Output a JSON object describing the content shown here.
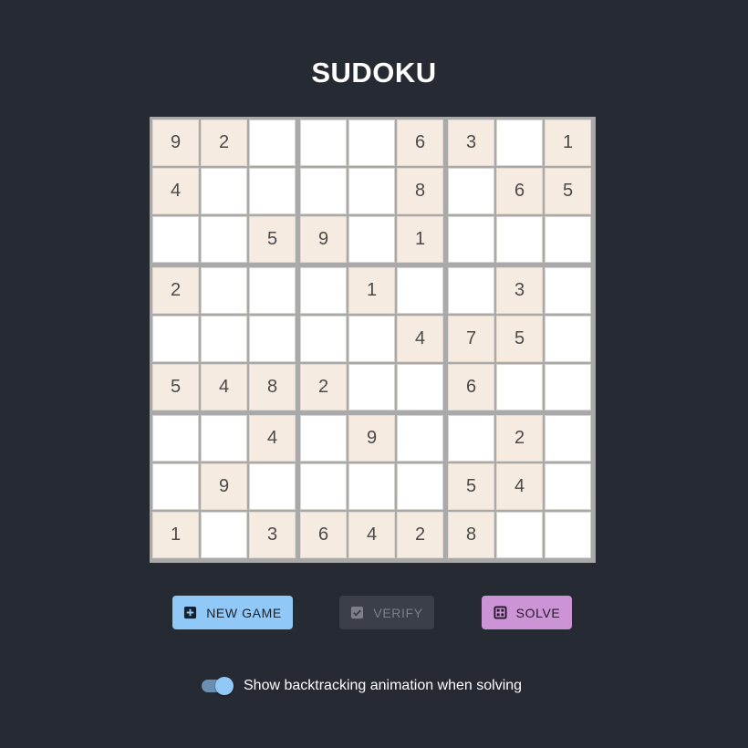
{
  "title": "SUDOKU",
  "board": {
    "grid": [
      [
        9,
        2,
        0,
        0,
        0,
        6,
        3,
        0,
        1
      ],
      [
        4,
        0,
        0,
        0,
        0,
        8,
        0,
        6,
        5
      ],
      [
        0,
        0,
        5,
        9,
        0,
        1,
        0,
        0,
        0
      ],
      [
        2,
        0,
        0,
        0,
        1,
        0,
        0,
        3,
        0
      ],
      [
        0,
        0,
        0,
        0,
        0,
        4,
        7,
        5,
        0
      ],
      [
        5,
        4,
        8,
        2,
        0,
        0,
        6,
        0,
        0
      ],
      [
        0,
        0,
        4,
        0,
        9,
        0,
        0,
        2,
        0
      ],
      [
        0,
        9,
        0,
        0,
        0,
        0,
        5,
        4,
        0
      ],
      [
        1,
        0,
        3,
        6,
        4,
        2,
        8,
        0,
        0
      ]
    ]
  },
  "buttons": {
    "new_game": {
      "label": "NEW GAME",
      "icon": "plus-box-icon",
      "enabled": true,
      "color": "#90c8f8"
    },
    "verify": {
      "label": "VERIFY",
      "icon": "checkbox-icon",
      "enabled": false,
      "color": "#3b3f48"
    },
    "solve": {
      "label": "SOLVE",
      "icon": "grid-solve-icon",
      "enabled": true,
      "color": "#cd93d7"
    }
  },
  "options": {
    "animation_toggle": {
      "label": "Show backtracking animation when solving",
      "checked": true,
      "color": "#90c8f8"
    }
  },
  "colors": {
    "background": "#262a33",
    "given_cell": "#f6ebe0",
    "empty_cell": "#ffffff",
    "box_border": "#a9a9a9"
  }
}
